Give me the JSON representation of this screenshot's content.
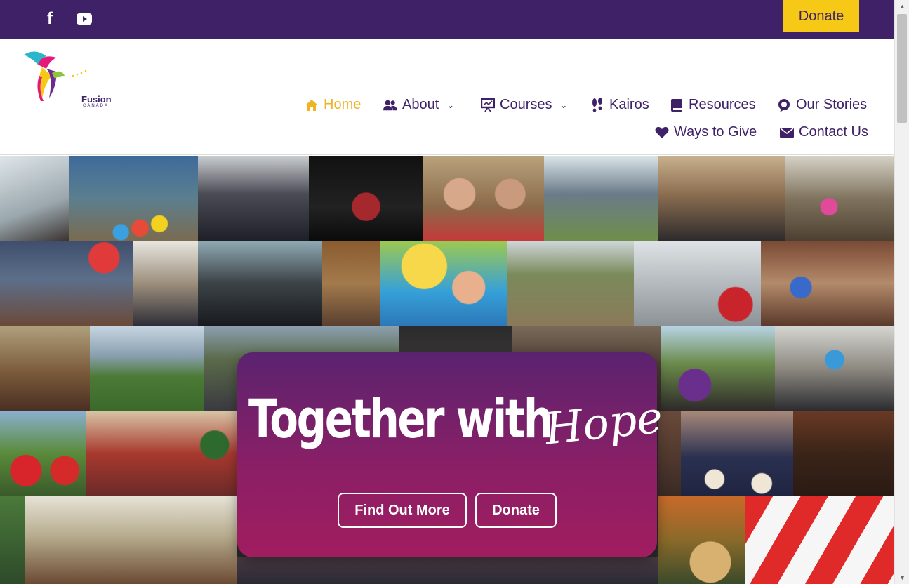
{
  "topbar": {
    "social": [
      {
        "name": "facebook-icon",
        "glyph": "f"
      },
      {
        "name": "youtube-icon",
        "glyph": "▶"
      }
    ],
    "donate_label": "Donate",
    "colors": {
      "bar": "#3f2168",
      "donate_bg": "#f6c916"
    }
  },
  "logo": {
    "text": "Fusion",
    "subtext": "CANADA"
  },
  "nav": {
    "items": [
      {
        "label": "Home",
        "icon": "home-icon",
        "active": true
      },
      {
        "label": "About",
        "icon": "users-icon",
        "dropdown": true
      },
      {
        "label": "Courses",
        "icon": "presentation-icon",
        "dropdown": true
      },
      {
        "label": "Kairos",
        "icon": "footprints-icon"
      },
      {
        "label": "Resources",
        "icon": "book-icon"
      },
      {
        "label": "Our Stories",
        "icon": "chat-bubble-icon"
      },
      {
        "label": "Ways to Give",
        "icon": "heart-icon"
      },
      {
        "label": "Contact Us",
        "icon": "envelope-icon"
      }
    ],
    "colors": {
      "default": "#3f2168",
      "active": "#f0b323"
    }
  },
  "hero": {
    "title": "Together with",
    "script": "Hope",
    "buttons": {
      "find_out_more": "Find Out More",
      "donate": "Donate"
    }
  }
}
